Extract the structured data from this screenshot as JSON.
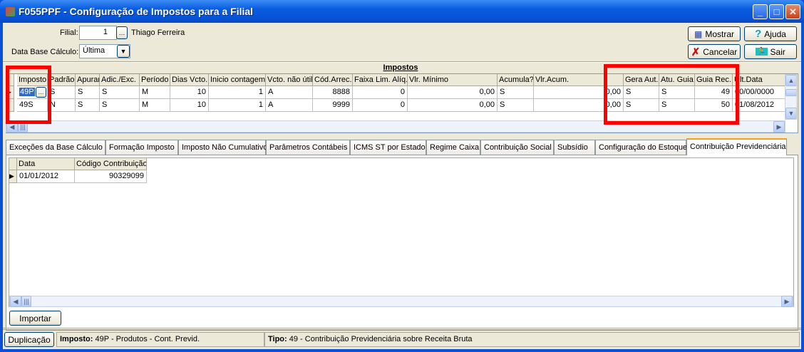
{
  "window": {
    "title": "F055PPF - Configuração de Impostos para a Filial",
    "minimize": "_",
    "maximize": "□",
    "close": "✕"
  },
  "filter": {
    "filial_label": "Filial:",
    "filial_value": "1",
    "filial_name": "Thiago Ferreira",
    "data_base_label": "Data Base Cálculo:",
    "data_base_value": "Última"
  },
  "buttons": {
    "mostrar": "Mostrar",
    "ajuda": "Ajuda",
    "cancelar": "Cancelar",
    "sair": "Sair",
    "importar": "Importar",
    "duplicacao": "Duplicação"
  },
  "impostos": {
    "title": "Impostos",
    "columns": [
      "Imposto",
      "Padrão",
      "Apurar",
      "Adic./Exc.",
      "Período",
      "Dias Vcto.",
      "Inicio contagem",
      "Vcto. não útil",
      "Cód.Arrec.",
      "Faixa Lim. Alíq.",
      "Vlr. Mínimo",
      "Acumula?",
      "Vlr.Acum.",
      "Gera Aut.",
      "Atu. Guia",
      "Guia Rec.",
      "Últ.Data"
    ],
    "rows": [
      [
        "49P",
        "S",
        "S",
        "S",
        "M",
        "10",
        "1",
        "A",
        "8888",
        "0",
        "0,00",
        "S",
        "0,00",
        "S",
        "S",
        "49",
        "00/00/0000"
      ],
      [
        "49S",
        "N",
        "S",
        "S",
        "M",
        "10",
        "1",
        "A",
        "9999",
        "0",
        "0,00",
        "S",
        "0,00",
        "S",
        "S",
        "50",
        "01/08/2012"
      ]
    ]
  },
  "tabs": [
    "Exceções da Base Cálculo",
    "Formação Imposto",
    "Imposto Não Cumulativo",
    "Parâmetros Contábeis",
    "ICMS ST por Estado",
    "Regime Caixa",
    "Contribuição Social",
    "Subsídio",
    "Configuração do Estoque",
    "Contribuição Previdenciária"
  ],
  "active_tab": "Contribuição Previdenciária",
  "contrib": {
    "columns": [
      "Data",
      "Código Contribuição"
    ],
    "rows": [
      [
        "01/01/2012",
        "90329099"
      ]
    ]
  },
  "status": {
    "imposto_label": "Imposto:",
    "imposto_value": "49P - Produtos - Cont. Previd.",
    "tipo_label": "Tipo:",
    "tipo_value": "49 - Contribuição Previdenciária sobre Receita Bruta"
  },
  "colors": {
    "annotation": "#ff0000",
    "selection": "#316ac5"
  }
}
